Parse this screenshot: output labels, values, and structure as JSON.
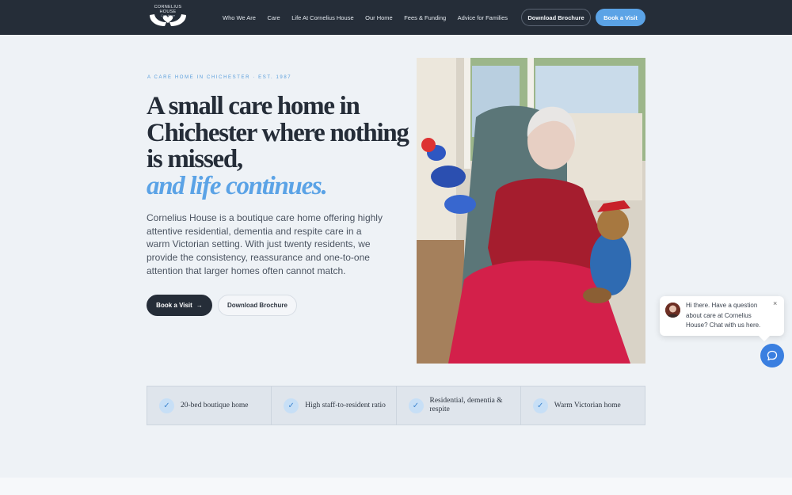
{
  "header": {
    "logo_name": "CORNELIUS HOUSE",
    "logo_tag": "Care Home",
    "nav": [
      "Who We Are",
      "Care",
      "Life At Cornelius House",
      "Our Home",
      "Fees & Funding",
      "Advice for Families"
    ],
    "download_brochure": "Download Brochure",
    "book_visit": "Book a Visit"
  },
  "hero": {
    "eyebrow": "A CARE HOME IN CHICHESTER · EST. 1987",
    "headline_lines": [
      "A small care home in",
      "Chichester where nothing",
      "is missed,"
    ],
    "headline_accent": "and life continues.",
    "intro": "Cornelius House is a boutique care home offering highly attentive residential, dementia and respite care in a warm Victorian setting. With just twenty residents, we provide the consistency, reassurance and one-to-one attention that larger homes often cannot match.",
    "book_visit": "Book a Visit",
    "book_visit_arrow": "→",
    "download_brochure": "Download Brochure"
  },
  "features": [
    {
      "label": "20-bed boutique home",
      "icon": "check-icon"
    },
    {
      "label": "High staff-to-resident ratio",
      "icon": "check-icon"
    },
    {
      "label": "Residential, dementia & respite",
      "icon": "check-icon"
    },
    {
      "label": "Warm Victorian home",
      "icon": "check-icon"
    }
  ],
  "chat": {
    "message": "Hi there. Have a question about care at Cornelius House? Chat with us here.",
    "close": "×"
  },
  "colors": {
    "header_bg": "#252d38",
    "accent": "#5ba3e6",
    "page_bg": "#eef2f6"
  }
}
